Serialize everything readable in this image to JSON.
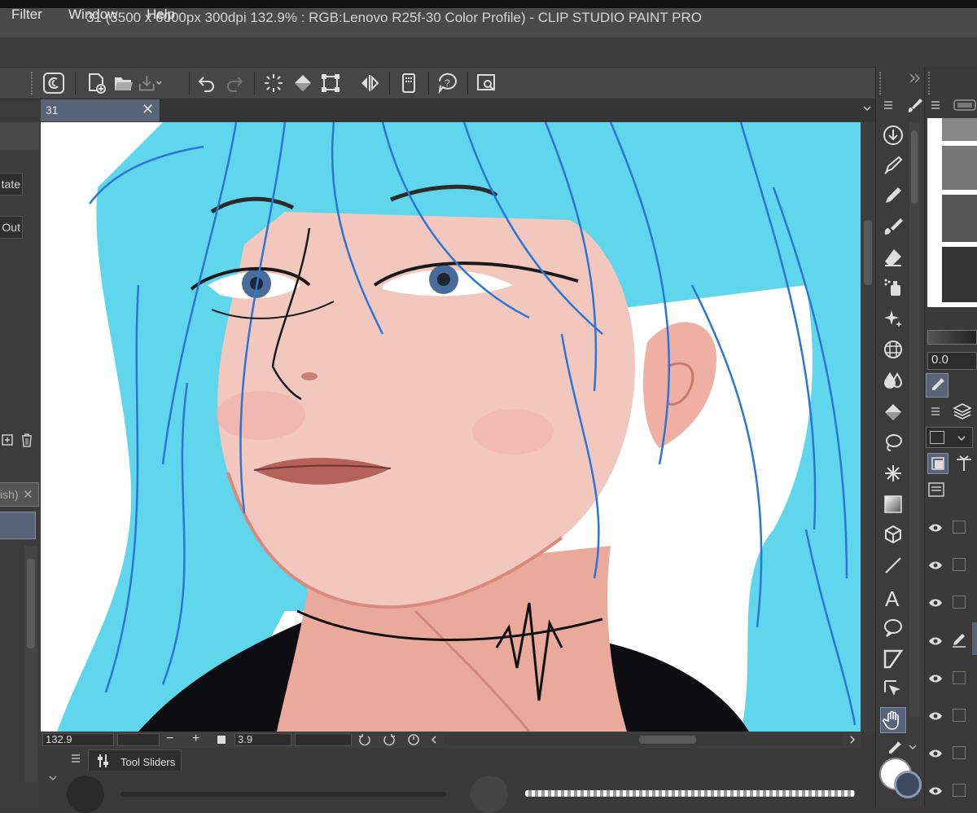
{
  "window": {
    "title": "31 (3500 x 6000px 300dpi 132.9% : RGB:Lenovo R25f-30 Color Profile)  - CLIP STUDIO PAINT PRO"
  },
  "menu": {
    "items": [
      "Filter",
      "Window",
      "Help"
    ]
  },
  "left_panel": {
    "rotate_label": "tate",
    "zoom_out_label": "Out",
    "subtool_tab_label": "ish)",
    "subtool_tab_close": "✕"
  },
  "document_tab": {
    "label": "31",
    "close": "✕"
  },
  "status": {
    "zoom": "132.9",
    "zoom_minus": "−",
    "zoom_plus": "+",
    "angle": "3.9"
  },
  "tool_sliders": {
    "label": "Tool Sliders"
  },
  "right_panel": {
    "value_field": "0.0"
  },
  "icons": {
    "command_bar": [
      "clip-studio-icon",
      "new-file-icon",
      "open-folder-icon",
      "save-icon",
      "undo-icon",
      "redo-icon",
      "loading-icon",
      "fill-icon",
      "transform-icon",
      "flip-icon",
      "device-icon",
      "help-icon",
      "search-icon"
    ],
    "tools": [
      "download-icon",
      "pen-icon",
      "pencil-icon",
      "brush-icon",
      "eraser-icon",
      "airbrush-icon",
      "decoration-icon",
      "grid-icon",
      "blend-icon",
      "fill-icon",
      "lasso-icon",
      "sparkle-icon",
      "gradient-icon",
      "3d-icon",
      "line-icon",
      "text-icon",
      "balloon-icon",
      "frame-icon",
      "select-layer-icon",
      "hand-icon",
      "eyedropper-icon"
    ]
  },
  "colors": {
    "hair": "#5fd6ec",
    "hair_stroke": "#2a76d6",
    "skin": "#f2c8be",
    "tab_active": "#5a6478"
  }
}
